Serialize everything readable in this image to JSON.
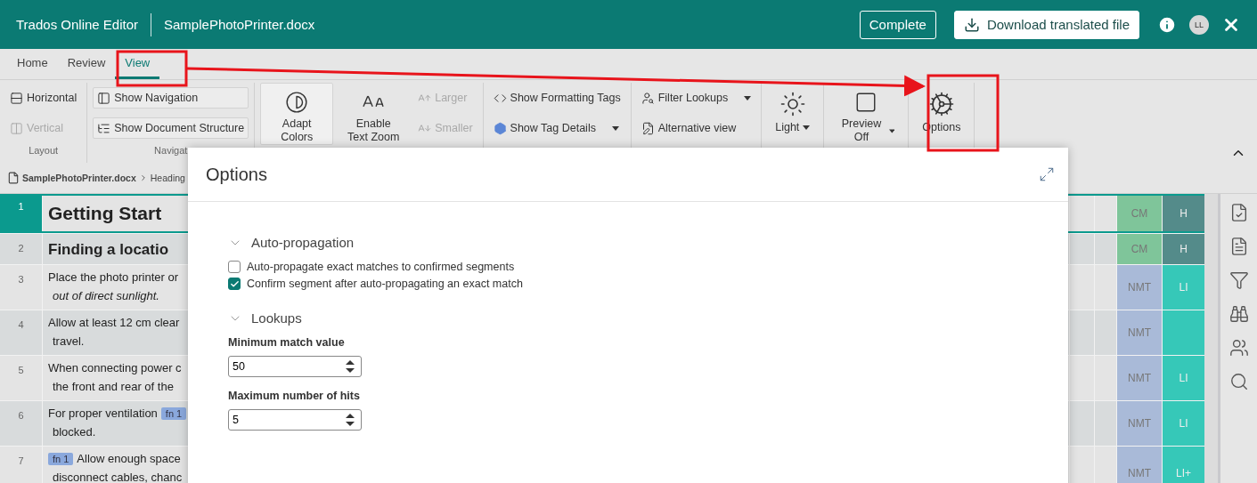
{
  "header": {
    "app_title": "Trados Online Editor",
    "file_name": "SamplePhotoPrinter.docx",
    "buttons": [
      {
        "kind": "outline",
        "label": "Complete"
      },
      {
        "kind": "download",
        "label": "Download translated file"
      }
    ],
    "avatar": "LL"
  },
  "tabs": [
    {
      "label": "Home",
      "selected": false
    },
    {
      "label": "Review",
      "selected": false
    },
    {
      "label": "View",
      "selected": true
    }
  ],
  "ribbon": {
    "groups": [
      {
        "label": "Layout",
        "items": [
          {
            "kind": "small",
            "label": "Horizontal",
            "disabled": false,
            "dropdown": false
          },
          {
            "kind": "small",
            "label": "Vertical",
            "disabled": true,
            "dropdown": false
          }
        ]
      },
      {
        "label": "Navigat",
        "items": [
          {
            "kind": "framed",
            "label": "Show Navigation",
            "disabled": false,
            "dropdown": false
          },
          {
            "kind": "framed",
            "label": "Show Document Structure",
            "disabled": false,
            "dropdown": false
          }
        ]
      },
      {
        "items": [
          {
            "kind": "large",
            "label": "Adapt Colors",
            "disabled": false,
            "dropdown": false,
            "pressed": true
          },
          {
            "kind": "large",
            "label": "Enable Text Zoom",
            "disabled": false,
            "dropdown": false,
            "pressed": false
          },
          {
            "kind": "small",
            "label": "Larger",
            "disabled": true,
            "dropdown": false,
            "pressed": false
          },
          {
            "kind": "small",
            "label": "Smaller",
            "disabled": true,
            "dropdown": false,
            "pressed": false
          }
        ]
      },
      {
        "items": [
          {
            "kind": "small",
            "label": "Show Formatting Tags",
            "disabled": false,
            "dropdown": false
          },
          {
            "kind": "small",
            "label": "Show Tag Details",
            "disabled": false,
            "dropdown": true
          }
        ]
      },
      {
        "items": [
          {
            "kind": "small",
            "label": "Filter Lookups",
            "disabled": false,
            "dropdown": true
          },
          {
            "kind": "small",
            "label": "Alternative view",
            "disabled": false,
            "dropdown": false
          }
        ]
      },
      {
        "items": [
          {
            "kind": "large",
            "label": "Light",
            "disabled": false,
            "dropdown": true
          }
        ]
      },
      {
        "items": [
          {
            "kind": "large",
            "label": "Preview Off",
            "disabled": false,
            "dropdown": true
          }
        ]
      },
      {
        "items": [
          {
            "kind": "large",
            "label": "Options",
            "disabled": false,
            "dropdown": false
          }
        ]
      }
    ]
  },
  "breadcrumb": [
    "SamplePhotoPrinter.docx",
    "Heading"
  ],
  "rows": [
    {
      "number": "1",
      "kind": "heading1",
      "selected": true,
      "lines": [
        [
          {
            "kind": "text",
            "text": "Getting Start"
          }
        ]
      ],
      "status": {
        "text": "CM",
        "color": "#7fc59a"
      },
      "match": {
        "text": "H",
        "color": "#548b8a"
      }
    },
    {
      "number": "2",
      "kind": "heading2",
      "selected": false,
      "lines": [
        [
          {
            "kind": "text",
            "text": "Finding a locatio"
          }
        ]
      ],
      "status": {
        "text": "CM",
        "color": "#7fc59a"
      },
      "match": {
        "text": "H",
        "color": "#548b8a"
      }
    },
    {
      "number": "3",
      "kind": "paragraph",
      "selected": false,
      "lines": [
        [
          {
            "kind": "text",
            "text": "Place the photo printer or"
          }
        ],
        [
          {
            "kind": "text",
            "text": "*out of direct sunlight.*"
          }
        ]
      ],
      "status": {
        "text": "NMT",
        "color": "#a9bad8"
      },
      "match": {
        "text": "LI",
        "color": "#36c8b8"
      }
    },
    {
      "number": "4",
      "kind": "paragraph",
      "selected": false,
      "lines": [
        [
          {
            "kind": "text",
            "text": "Allow at least 12 cm clear"
          }
        ],
        [
          {
            "kind": "text",
            "text": "travel."
          }
        ]
      ],
      "status": {
        "text": "NMT",
        "color": "#a9bad8"
      },
      "match": {
        "color": "#36c8b8"
      }
    },
    {
      "number": "5",
      "kind": "paragraph",
      "selected": false,
      "lines": [
        [
          {
            "kind": "text",
            "text": "When connecting power c"
          }
        ],
        [
          {
            "kind": "text",
            "text": "the front and rear of the"
          }
        ]
      ],
      "status": {
        "text": "NMT",
        "color": "#a9bad8"
      },
      "match": {
        "text": "LI",
        "color": "#36c8b8"
      }
    },
    {
      "number": "6",
      "kind": "paragraph",
      "selected": false,
      "lines": [
        [
          {
            "kind": "text",
            "text": "For proper ventilation"
          },
          {
            "kind": "tag",
            "text": "fn 1"
          }
        ],
        [
          {
            "kind": "text",
            "text": "blocked."
          }
        ]
      ],
      "status": {
        "text": "NMT",
        "color": "#a9bad8"
      },
      "match": {
        "text": "LI",
        "color": "#36c8b8"
      }
    },
    {
      "number": "7",
      "kind": "paragraph",
      "selected": false,
      "lines": [
        [
          {
            "kind": "tag",
            "text": "fn 1"
          },
          {
            "kind": "text",
            "text": "Allow enough space"
          }
        ],
        [
          {
            "kind": "text",
            "text": "disconnect cables, chanc"
          }
        ]
      ],
      "status": {
        "text": "NMT",
        "color": "#a9bad8"
      },
      "match": {
        "text": "LI+",
        "color": "#36c8b8"
      }
    }
  ],
  "dialog": {
    "title": "Options",
    "sections": [
      {
        "title": "Auto-propagation",
        "expanded": true,
        "items": [
          {
            "kind": "checkbox",
            "label": "Auto-propagate exact matches to confirmed segments",
            "checked": false
          },
          {
            "kind": "checkbox",
            "label": "Confirm segment after auto-propagating an exact match",
            "checked": true
          }
        ]
      },
      {
        "title": "Lookups",
        "expanded": true,
        "items": [
          {
            "kind": "number",
            "label": "Minimum match value",
            "value": "50"
          },
          {
            "kind": "number",
            "label": "Maximum number of hits",
            "value": "5"
          }
        ]
      }
    ]
  }
}
